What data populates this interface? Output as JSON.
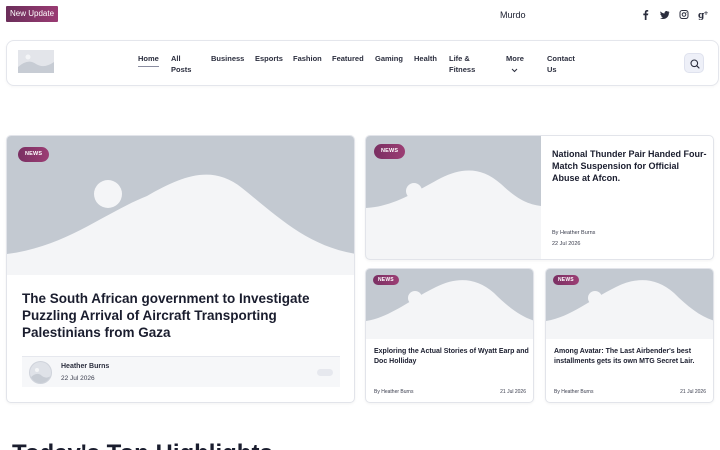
{
  "topbar": {
    "new_update_label": "New Update",
    "ticker_text": "Murdoch",
    "socials": [
      "facebook-icon",
      "twitter-icon",
      "instagram-icon",
      "google-plus-icon"
    ]
  },
  "nav": {
    "items": [
      {
        "label": "Home"
      },
      {
        "label": "All Posts"
      },
      {
        "label": "Business"
      },
      {
        "label": "Esports"
      },
      {
        "label": "Fashion"
      },
      {
        "label": "Featured"
      },
      {
        "label": "Gaming"
      },
      {
        "label": "Health"
      },
      {
        "label": "Life & Fitness"
      },
      {
        "label": "More"
      },
      {
        "label": "Contact Us"
      }
    ]
  },
  "main_post": {
    "badge": "NEWS",
    "title": "The South African government to Investigate Puzzling Arrival of Aircraft Transporting Palestinians from Gaza",
    "author": "Heather Burns",
    "date": "22 Jul 2026"
  },
  "side_post": {
    "badge": "NEWS",
    "title": "National Thunder Pair Handed Four-Match Suspension for Official Abuse at Afcon.",
    "author_line": "By Heather Burns",
    "date": "22 Jul 2026"
  },
  "small_posts": [
    {
      "badge": "NEWS",
      "title": "Exploring the Actual Stories of Wyatt Earp and Doc Holliday",
      "author_line": "By Heather Burns",
      "date": "21 Jul 2026"
    },
    {
      "badge": "NEWS",
      "title": "Among Avatar: The Last Airbender's best installments gets its own MTG Secret Lair.",
      "author_line": "By Heather Burns",
      "date": "21 Jul 2026"
    }
  ],
  "section": {
    "heading": "Today's Top Highlights"
  },
  "colors": {
    "accent": "#8a3568",
    "placeholder": "#c3c9d1"
  }
}
